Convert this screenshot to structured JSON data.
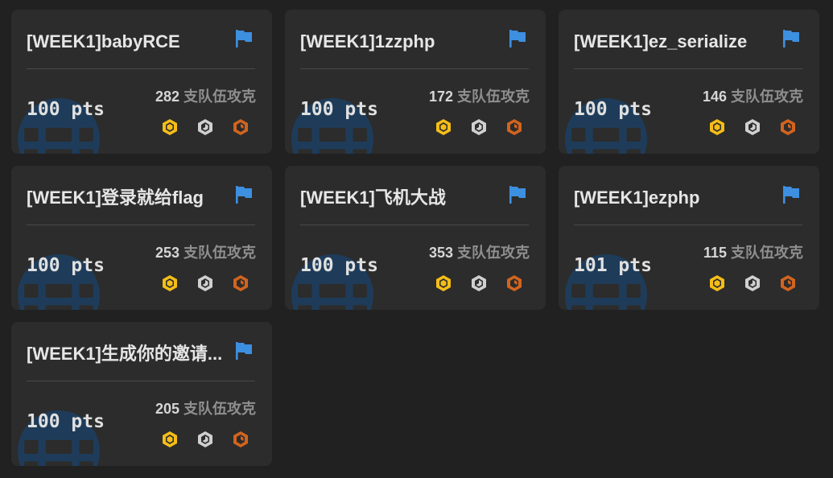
{
  "colors": {
    "page_bg": "#212121",
    "card_bg": "#2c2c2c",
    "flag": "#3d8fe0",
    "globe_watermark": "#1e3c5a",
    "gold": "#f5bd18",
    "silver": "#d0d0d0",
    "bronze": "#d2641e"
  },
  "challenges": [
    {
      "title": "[WEEK1]babyRCE",
      "points": "100 pts",
      "solves": "282",
      "solves_label": "支队伍攻克",
      "icon": "flag-icon"
    },
    {
      "title": "[WEEK1]1zzphp",
      "points": "100 pts",
      "solves": "172",
      "solves_label": "支队伍攻克",
      "icon": "flag-icon"
    },
    {
      "title": "[WEEK1]ez_serialize",
      "points": "100 pts",
      "solves": "146",
      "solves_label": "支队伍攻克",
      "icon": "flag-icon"
    },
    {
      "title": "[WEEK1]登录就给flag",
      "points": "100 pts",
      "solves": "253",
      "solves_label": "支队伍攻克",
      "icon": "flag-icon"
    },
    {
      "title": "[WEEK1]飞机大战",
      "points": "100 pts",
      "solves": "353",
      "solves_label": "支队伍攻克",
      "icon": "flag-icon"
    },
    {
      "title": "[WEEK1]ezphp",
      "points": "101 pts",
      "solves": "115",
      "solves_label": "支队伍攻克",
      "icon": "flag-icon"
    },
    {
      "title": "[WEEK1]生成你的邀请...",
      "points": "100 pts",
      "solves": "205",
      "solves_label": "支队伍攻克",
      "icon": "flag-icon"
    }
  ],
  "medal_icons": [
    "gold-medal-icon",
    "silver-medal-icon",
    "bronze-medal-icon"
  ],
  "category_icon": "globe-icon"
}
